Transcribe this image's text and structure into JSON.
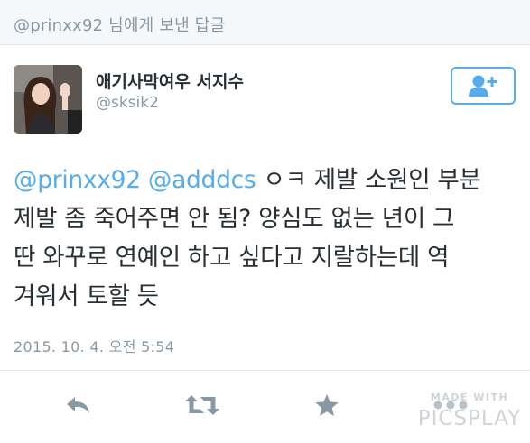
{
  "reply_header": {
    "text": "@prinxx92 님에게 보낸 답글"
  },
  "author": {
    "display_name": "애기사막여우 서지수",
    "screen_name": "@sksik2"
  },
  "tweet": {
    "mentions": [
      "@prinxx92",
      "@adddcs"
    ],
    "line1_rest": " ㅇㅋ 제발 소원인 부분",
    "line2": "제발 좀 죽어주면 안 됨? 양심도 없는 년이 그",
    "line3": "딴 와꾸로 연예인 하고 싶다고 지랄하는데 역",
    "line4": "겨워서 토할 듯",
    "timestamp": "2015. 10. 4. 오전 5:54"
  },
  "actions": {
    "reply_icon": "reply-icon",
    "retweet_icon": "retweet-icon",
    "like_icon": "star-icon",
    "more_icon": "more-icon"
  },
  "watermark": {
    "line1": "MADE WITH",
    "line2": "PICSPLAY"
  },
  "colors": {
    "accent": "#55acee",
    "muted": "#8899a6",
    "text": "#292f33"
  }
}
